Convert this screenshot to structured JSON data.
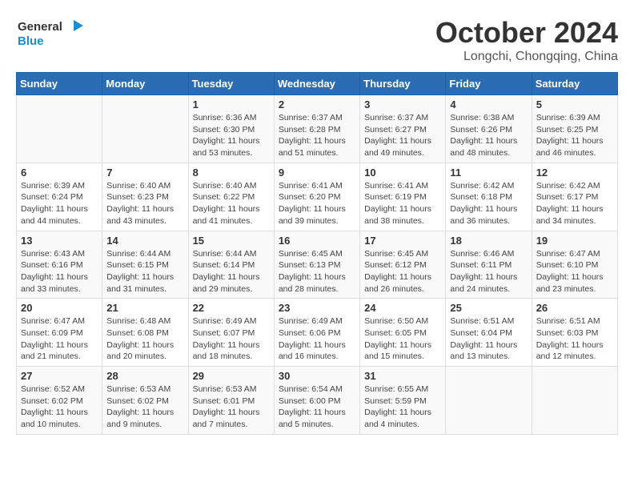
{
  "header": {
    "logo_general": "General",
    "logo_blue": "Blue",
    "month_title": "October 2024",
    "location": "Longchi, Chongqing, China"
  },
  "weekdays": [
    "Sunday",
    "Monday",
    "Tuesday",
    "Wednesday",
    "Thursday",
    "Friday",
    "Saturday"
  ],
  "weeks": [
    [
      {
        "day": "",
        "sunrise": "",
        "sunset": "",
        "daylight": ""
      },
      {
        "day": "",
        "sunrise": "",
        "sunset": "",
        "daylight": ""
      },
      {
        "day": "1",
        "sunrise": "Sunrise: 6:36 AM",
        "sunset": "Sunset: 6:30 PM",
        "daylight": "Daylight: 11 hours and 53 minutes."
      },
      {
        "day": "2",
        "sunrise": "Sunrise: 6:37 AM",
        "sunset": "Sunset: 6:28 PM",
        "daylight": "Daylight: 11 hours and 51 minutes."
      },
      {
        "day": "3",
        "sunrise": "Sunrise: 6:37 AM",
        "sunset": "Sunset: 6:27 PM",
        "daylight": "Daylight: 11 hours and 49 minutes."
      },
      {
        "day": "4",
        "sunrise": "Sunrise: 6:38 AM",
        "sunset": "Sunset: 6:26 PM",
        "daylight": "Daylight: 11 hours and 48 minutes."
      },
      {
        "day": "5",
        "sunrise": "Sunrise: 6:39 AM",
        "sunset": "Sunset: 6:25 PM",
        "daylight": "Daylight: 11 hours and 46 minutes."
      }
    ],
    [
      {
        "day": "6",
        "sunrise": "Sunrise: 6:39 AM",
        "sunset": "Sunset: 6:24 PM",
        "daylight": "Daylight: 11 hours and 44 minutes."
      },
      {
        "day": "7",
        "sunrise": "Sunrise: 6:40 AM",
        "sunset": "Sunset: 6:23 PM",
        "daylight": "Daylight: 11 hours and 43 minutes."
      },
      {
        "day": "8",
        "sunrise": "Sunrise: 6:40 AM",
        "sunset": "Sunset: 6:22 PM",
        "daylight": "Daylight: 11 hours and 41 minutes."
      },
      {
        "day": "9",
        "sunrise": "Sunrise: 6:41 AM",
        "sunset": "Sunset: 6:20 PM",
        "daylight": "Daylight: 11 hours and 39 minutes."
      },
      {
        "day": "10",
        "sunrise": "Sunrise: 6:41 AM",
        "sunset": "Sunset: 6:19 PM",
        "daylight": "Daylight: 11 hours and 38 minutes."
      },
      {
        "day": "11",
        "sunrise": "Sunrise: 6:42 AM",
        "sunset": "Sunset: 6:18 PM",
        "daylight": "Daylight: 11 hours and 36 minutes."
      },
      {
        "day": "12",
        "sunrise": "Sunrise: 6:42 AM",
        "sunset": "Sunset: 6:17 PM",
        "daylight": "Daylight: 11 hours and 34 minutes."
      }
    ],
    [
      {
        "day": "13",
        "sunrise": "Sunrise: 6:43 AM",
        "sunset": "Sunset: 6:16 PM",
        "daylight": "Daylight: 11 hours and 33 minutes."
      },
      {
        "day": "14",
        "sunrise": "Sunrise: 6:44 AM",
        "sunset": "Sunset: 6:15 PM",
        "daylight": "Daylight: 11 hours and 31 minutes."
      },
      {
        "day": "15",
        "sunrise": "Sunrise: 6:44 AM",
        "sunset": "Sunset: 6:14 PM",
        "daylight": "Daylight: 11 hours and 29 minutes."
      },
      {
        "day": "16",
        "sunrise": "Sunrise: 6:45 AM",
        "sunset": "Sunset: 6:13 PM",
        "daylight": "Daylight: 11 hours and 28 minutes."
      },
      {
        "day": "17",
        "sunrise": "Sunrise: 6:45 AM",
        "sunset": "Sunset: 6:12 PM",
        "daylight": "Daylight: 11 hours and 26 minutes."
      },
      {
        "day": "18",
        "sunrise": "Sunrise: 6:46 AM",
        "sunset": "Sunset: 6:11 PM",
        "daylight": "Daylight: 11 hours and 24 minutes."
      },
      {
        "day": "19",
        "sunrise": "Sunrise: 6:47 AM",
        "sunset": "Sunset: 6:10 PM",
        "daylight": "Daylight: 11 hours and 23 minutes."
      }
    ],
    [
      {
        "day": "20",
        "sunrise": "Sunrise: 6:47 AM",
        "sunset": "Sunset: 6:09 PM",
        "daylight": "Daylight: 11 hours and 21 minutes."
      },
      {
        "day": "21",
        "sunrise": "Sunrise: 6:48 AM",
        "sunset": "Sunset: 6:08 PM",
        "daylight": "Daylight: 11 hours and 20 minutes."
      },
      {
        "day": "22",
        "sunrise": "Sunrise: 6:49 AM",
        "sunset": "Sunset: 6:07 PM",
        "daylight": "Daylight: 11 hours and 18 minutes."
      },
      {
        "day": "23",
        "sunrise": "Sunrise: 6:49 AM",
        "sunset": "Sunset: 6:06 PM",
        "daylight": "Daylight: 11 hours and 16 minutes."
      },
      {
        "day": "24",
        "sunrise": "Sunrise: 6:50 AM",
        "sunset": "Sunset: 6:05 PM",
        "daylight": "Daylight: 11 hours and 15 minutes."
      },
      {
        "day": "25",
        "sunrise": "Sunrise: 6:51 AM",
        "sunset": "Sunset: 6:04 PM",
        "daylight": "Daylight: 11 hours and 13 minutes."
      },
      {
        "day": "26",
        "sunrise": "Sunrise: 6:51 AM",
        "sunset": "Sunset: 6:03 PM",
        "daylight": "Daylight: 11 hours and 12 minutes."
      }
    ],
    [
      {
        "day": "27",
        "sunrise": "Sunrise: 6:52 AM",
        "sunset": "Sunset: 6:02 PM",
        "daylight": "Daylight: 11 hours and 10 minutes."
      },
      {
        "day": "28",
        "sunrise": "Sunrise: 6:53 AM",
        "sunset": "Sunset: 6:02 PM",
        "daylight": "Daylight: 11 hours and 9 minutes."
      },
      {
        "day": "29",
        "sunrise": "Sunrise: 6:53 AM",
        "sunset": "Sunset: 6:01 PM",
        "daylight": "Daylight: 11 hours and 7 minutes."
      },
      {
        "day": "30",
        "sunrise": "Sunrise: 6:54 AM",
        "sunset": "Sunset: 6:00 PM",
        "daylight": "Daylight: 11 hours and 5 minutes."
      },
      {
        "day": "31",
        "sunrise": "Sunrise: 6:55 AM",
        "sunset": "Sunset: 5:59 PM",
        "daylight": "Daylight: 11 hours and 4 minutes."
      },
      {
        "day": "",
        "sunrise": "",
        "sunset": "",
        "daylight": ""
      },
      {
        "day": "",
        "sunrise": "",
        "sunset": "",
        "daylight": ""
      }
    ]
  ]
}
